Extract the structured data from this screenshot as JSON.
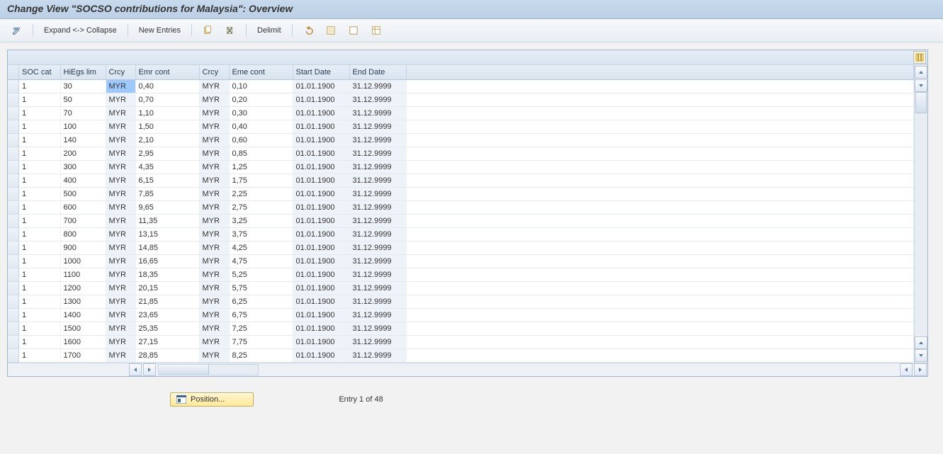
{
  "title": "Change View \"SOCSO contributions for Malaysia\": Overview",
  "toolbar": {
    "expand_collapse": "Expand <-> Collapse",
    "new_entries": "New Entries",
    "delimit": "Delimit"
  },
  "columns": {
    "soc_cat": "SOC cat",
    "hiegs_lim": "HiEgs lim",
    "crcy": "Crcy",
    "emr_cont": "Emr cont",
    "crcy2": "Crcy",
    "eme_cont": "Eme cont",
    "start_date": "Start Date",
    "end_date": "End Date"
  },
  "rows": [
    {
      "soc": "1",
      "lim": "30",
      "c1": "MYR",
      "emr": "0,40",
      "c2": "MYR",
      "eme": "0,10",
      "sd": "01.01.1900",
      "ed": "31.12.9999"
    },
    {
      "soc": "1",
      "lim": "50",
      "c1": "MYR",
      "emr": "0,70",
      "c2": "MYR",
      "eme": "0,20",
      "sd": "01.01.1900",
      "ed": "31.12.9999"
    },
    {
      "soc": "1",
      "lim": "70",
      "c1": "MYR",
      "emr": "1,10",
      "c2": "MYR",
      "eme": "0,30",
      "sd": "01.01.1900",
      "ed": "31.12.9999"
    },
    {
      "soc": "1",
      "lim": "100",
      "c1": "MYR",
      "emr": "1,50",
      "c2": "MYR",
      "eme": "0,40",
      "sd": "01.01.1900",
      "ed": "31.12.9999"
    },
    {
      "soc": "1",
      "lim": "140",
      "c1": "MYR",
      "emr": "2,10",
      "c2": "MYR",
      "eme": "0,60",
      "sd": "01.01.1900",
      "ed": "31.12.9999"
    },
    {
      "soc": "1",
      "lim": "200",
      "c1": "MYR",
      "emr": "2,95",
      "c2": "MYR",
      "eme": "0,85",
      "sd": "01.01.1900",
      "ed": "31.12.9999"
    },
    {
      "soc": "1",
      "lim": "300",
      "c1": "MYR",
      "emr": "4,35",
      "c2": "MYR",
      "eme": "1,25",
      "sd": "01.01.1900",
      "ed": "31.12.9999"
    },
    {
      "soc": "1",
      "lim": "400",
      "c1": "MYR",
      "emr": "6,15",
      "c2": "MYR",
      "eme": "1,75",
      "sd": "01.01.1900",
      "ed": "31.12.9999"
    },
    {
      "soc": "1",
      "lim": "500",
      "c1": "MYR",
      "emr": "7,85",
      "c2": "MYR",
      "eme": "2,25",
      "sd": "01.01.1900",
      "ed": "31.12.9999"
    },
    {
      "soc": "1",
      "lim": "600",
      "c1": "MYR",
      "emr": "9,65",
      "c2": "MYR",
      "eme": "2,75",
      "sd": "01.01.1900",
      "ed": "31.12.9999"
    },
    {
      "soc": "1",
      "lim": "700",
      "c1": "MYR",
      "emr": "11,35",
      "c2": "MYR",
      "eme": "3,25",
      "sd": "01.01.1900",
      "ed": "31.12.9999"
    },
    {
      "soc": "1",
      "lim": "800",
      "c1": "MYR",
      "emr": "13,15",
      "c2": "MYR",
      "eme": "3,75",
      "sd": "01.01.1900",
      "ed": "31.12.9999"
    },
    {
      "soc": "1",
      "lim": "900",
      "c1": "MYR",
      "emr": "14,85",
      "c2": "MYR",
      "eme": "4,25",
      "sd": "01.01.1900",
      "ed": "31.12.9999"
    },
    {
      "soc": "1",
      "lim": "1000",
      "c1": "MYR",
      "emr": "16,65",
      "c2": "MYR",
      "eme": "4,75",
      "sd": "01.01.1900",
      "ed": "31.12.9999"
    },
    {
      "soc": "1",
      "lim": "1100",
      "c1": "MYR",
      "emr": "18,35",
      "c2": "MYR",
      "eme": "5,25",
      "sd": "01.01.1900",
      "ed": "31.12.9999"
    },
    {
      "soc": "1",
      "lim": "1200",
      "c1": "MYR",
      "emr": "20,15",
      "c2": "MYR",
      "eme": "5,75",
      "sd": "01.01.1900",
      "ed": "31.12.9999"
    },
    {
      "soc": "1",
      "lim": "1300",
      "c1": "MYR",
      "emr": "21,85",
      "c2": "MYR",
      "eme": "6,25",
      "sd": "01.01.1900",
      "ed": "31.12.9999"
    },
    {
      "soc": "1",
      "lim": "1400",
      "c1": "MYR",
      "emr": "23,65",
      "c2": "MYR",
      "eme": "6,75",
      "sd": "01.01.1900",
      "ed": "31.12.9999"
    },
    {
      "soc": "1",
      "lim": "1500",
      "c1": "MYR",
      "emr": "25,35",
      "c2": "MYR",
      "eme": "7,25",
      "sd": "01.01.1900",
      "ed": "31.12.9999"
    },
    {
      "soc": "1",
      "lim": "1600",
      "c1": "MYR",
      "emr": "27,15",
      "c2": "MYR",
      "eme": "7,75",
      "sd": "01.01.1900",
      "ed": "31.12.9999"
    },
    {
      "soc": "1",
      "lim": "1700",
      "c1": "MYR",
      "emr": "28,85",
      "c2": "MYR",
      "eme": "8,25",
      "sd": "01.01.1900",
      "ed": "31.12.9999"
    }
  ],
  "footer": {
    "position_label": "Position...",
    "entry_text": "Entry 1 of 48"
  }
}
